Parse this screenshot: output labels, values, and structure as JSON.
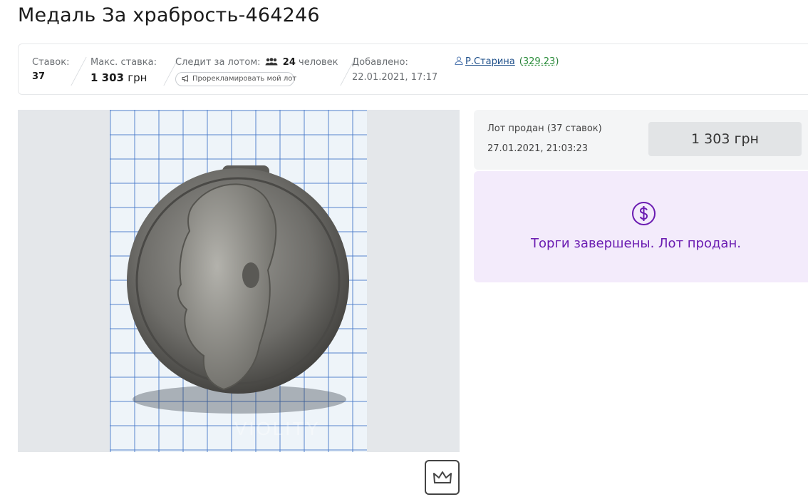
{
  "lot": {
    "title": "Медаль За храбрость-464246"
  },
  "stats": {
    "bids_label": "Ставок:",
    "bids_value": "37",
    "max_bid_label": "Макс. ставка:",
    "max_bid_amount": "1 303",
    "max_bid_currency": "грн",
    "watchers_label": "Следит за лотом:",
    "watchers_count": "24",
    "watchers_unit": "человек",
    "promote_button": "Прорекламировать мой лот",
    "added_label": "Добавлено:",
    "added_value": "22.01.2021, 17:17"
  },
  "seller": {
    "name": "Р.Старина",
    "rating": "329.23"
  },
  "photo": {
    "watermark": "VIOLITY"
  },
  "sale": {
    "status": "Лот продан (37 ставок)",
    "date": "27.01.2021, 21:03:23",
    "price": "1 303 грн",
    "ended_message": "Торги завершены. Лот продан."
  },
  "colors": {
    "accent_purple": "#6a1bb1",
    "link_blue": "#1e4f8a",
    "rating_green": "#2a8d3a"
  }
}
